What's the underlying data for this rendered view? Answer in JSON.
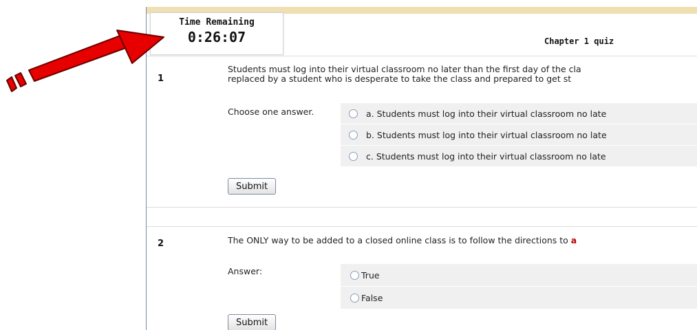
{
  "timer": {
    "label": "Time Remaining",
    "value": "0:26:07"
  },
  "quiz": {
    "title": "Chapter 1 quiz"
  },
  "questions": [
    {
      "number": "1",
      "text_line1": "Students must log into their virtual classroom no later than the first day of the cla",
      "text_line2": "replaced by a student who is desperate to take the class and prepared to get st",
      "prompt": "Choose one answer.",
      "options": [
        "a. Students must log into their virtual classroom no late",
        "b. Students must log into their virtual classroom no late",
        "c. Students must log into their virtual classroom no late"
      ],
      "submit_label": "Submit"
    },
    {
      "number": "2",
      "text": "The ONLY way to be added to a closed online class is to follow the directions to",
      "link_fragment": "a",
      "prompt": "Answer:",
      "options": [
        "True",
        "False"
      ],
      "submit_label": "Submit"
    }
  ],
  "colors": {
    "arrow": "#e00000",
    "header_bar": "#f0dfb1",
    "option_bg": "#f0f0f0"
  }
}
